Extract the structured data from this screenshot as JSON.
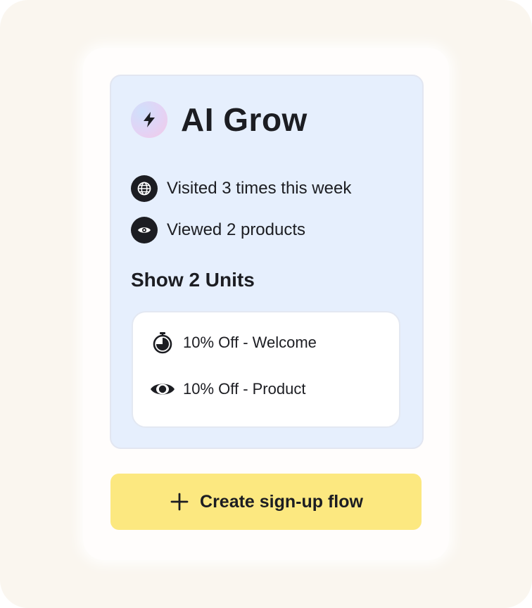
{
  "brand": {
    "title": "AI Grow",
    "icon": "lightning-icon"
  },
  "stats": [
    {
      "icon": "globe-icon",
      "text": "Visited 3 times this week"
    },
    {
      "icon": "eye-icon",
      "text": "Viewed 2 products"
    }
  ],
  "units": {
    "title": "Show 2 Units",
    "items": [
      {
        "icon": "timer-icon",
        "label": "10% Off - Welcome"
      },
      {
        "icon": "eye-icon",
        "label": "10% Off - Product"
      }
    ]
  },
  "cta": {
    "icon": "plus-icon",
    "label": "Create sign-up flow"
  },
  "colors": {
    "background": "#faf6ef",
    "panel": "#e6effd",
    "cta": "#fce880",
    "text": "#1c1d22"
  }
}
